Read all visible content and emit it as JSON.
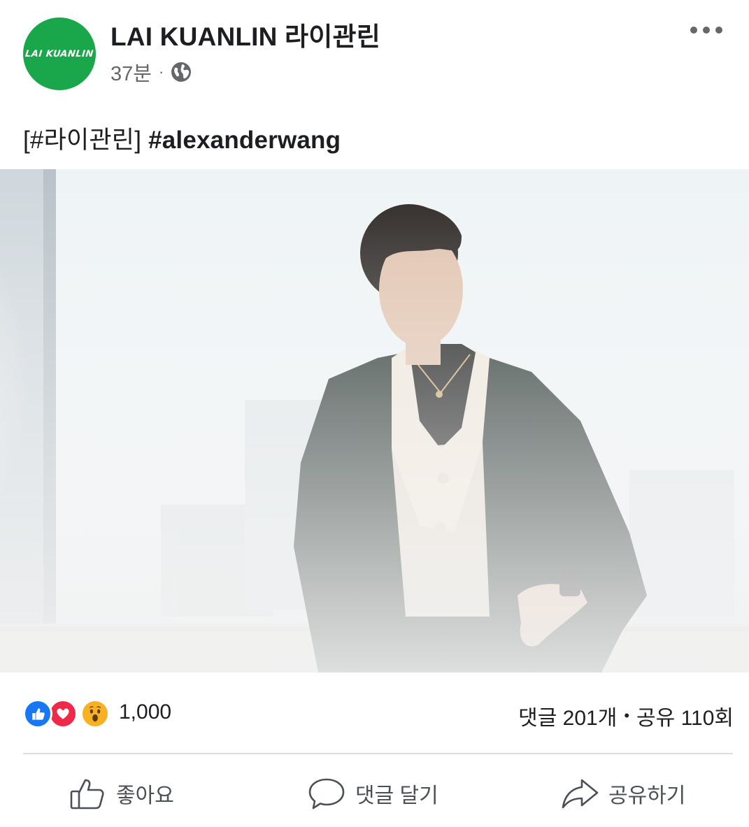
{
  "header": {
    "avatar_text": "LAI KUANLIN",
    "page_name": "LAI KUANLIN 라이관린",
    "time": "37분",
    "dot": "·",
    "privacy_icon": "globe-icon",
    "more_icon": "more-icon"
  },
  "post": {
    "hashtag1": "[#라이관린]",
    "hashtag2": "#alexanderwang"
  },
  "stats": {
    "reactions": [
      "like-reaction-icon",
      "love-reaction-icon",
      "wow-reaction-icon"
    ],
    "reaction_count": "1,000",
    "comments": "댓글 201개",
    "sep": "•",
    "shares": "공유 110회"
  },
  "actions": {
    "like_label": "좋아요",
    "comment_label": "댓글 달기",
    "share_label": "공유하기"
  },
  "colors": {
    "brand_green": "#1aa64a",
    "like_blue": "#1877f2",
    "love_red": "#f02849",
    "wow_yellow": "#f7b125"
  }
}
